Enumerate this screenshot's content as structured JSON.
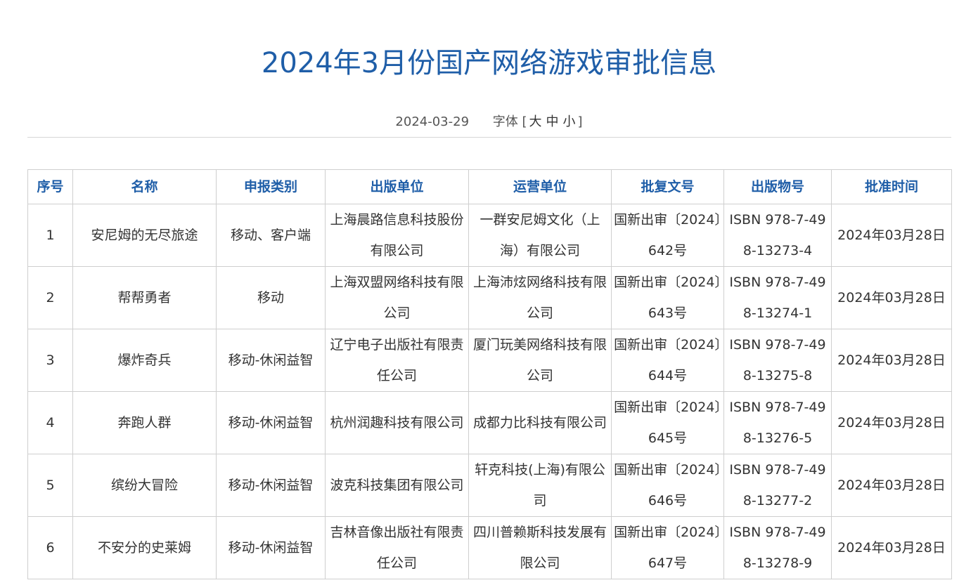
{
  "title": "2024年3月份国产网络游戏审批信息",
  "meta": {
    "date": "2024-03-29",
    "font_label": "字体",
    "bracket_open": "[",
    "bracket_close": "]",
    "font_large": "大",
    "font_medium": "中",
    "font_small": "小"
  },
  "table": {
    "headers": [
      "序号",
      "名称",
      "申报类别",
      "出版单位",
      "运营单位",
      "批复文号",
      "出版物号",
      "批准时间"
    ],
    "rows": [
      [
        "1",
        "安尼姆的无尽旅途",
        "移动、客户端",
        "上海晨路信息科技股份有限公司",
        "一群安尼姆文化（上海）有限公司",
        "国新出审〔2024〕642号",
        "ISBN 978-7-498-13273-4",
        "2024年03月28日"
      ],
      [
        "2",
        "帮帮勇者",
        "移动",
        "上海双盟网络科技有限公司",
        "上海沛炫网络科技有限公司",
        "国新出审〔2024〕643号",
        "ISBN 978-7-498-13274-1",
        "2024年03月28日"
      ],
      [
        "3",
        "爆炸奇兵",
        "移动-休闲益智",
        "辽宁电子出版社有限责任公司",
        "厦门玩美网络科技有限公司",
        "国新出审〔2024〕644号",
        "ISBN 978-7-498-13275-8",
        "2024年03月28日"
      ],
      [
        "4",
        "奔跑人群",
        "移动-休闲益智",
        "杭州润趣科技有限公司",
        "成都力比科技有限公司",
        "国新出审〔2024〕645号",
        "ISBN 978-7-498-13276-5",
        "2024年03月28日"
      ],
      [
        "5",
        "缤纷大冒险",
        "移动-休闲益智",
        "波克科技集团有限公司",
        "轩克科技(上海)有限公司",
        "国新出审〔2024〕646号",
        "ISBN 978-7-498-13277-2",
        "2024年03月28日"
      ],
      [
        "6",
        "不安分的史莱姆",
        "移动-休闲益智",
        "吉林音像出版社有限责任公司",
        "四川普赖斯科技发展有限公司",
        "国新出审〔2024〕647号",
        "ISBN 978-7-498-13278-9",
        "2024年03月28日"
      ]
    ]
  },
  "colors": {
    "title": "#1f5ea8",
    "header_text": "#1f5ea8",
    "border": "#cfcfcf",
    "divider": "#d6d6d6"
  }
}
